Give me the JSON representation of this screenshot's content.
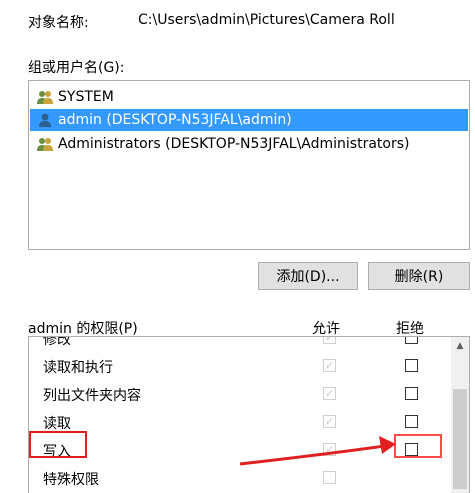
{
  "object": {
    "label": "对象名称:",
    "path": "C:\\Users\\admin\\Pictures\\Camera Roll"
  },
  "groups": {
    "label": "组或用户名(G):",
    "items": [
      {
        "label": "SYSTEM",
        "icon": "users-group-icon",
        "selected": false
      },
      {
        "label": "admin (DESKTOP-N53JFAL\\admin)",
        "icon": "user-icon",
        "selected": true
      },
      {
        "label": "Administrators (DESKTOP-N53JFAL\\Administrators)",
        "icon": "users-group-icon",
        "selected": false
      }
    ]
  },
  "buttons": {
    "add": "添加(D)...",
    "remove": "删除(R)"
  },
  "permissions": {
    "title": "admin 的权限(P)",
    "allow_header": "允许",
    "deny_header": "拒绝",
    "rows": [
      {
        "label": "修改",
        "allow": true,
        "deny": false
      },
      {
        "label": "读取和执行",
        "allow": true,
        "deny": false
      },
      {
        "label": "列出文件夹内容",
        "allow": true,
        "deny": false
      },
      {
        "label": "读取",
        "allow": true,
        "deny": false
      },
      {
        "label": "写入",
        "allow": true,
        "deny": false
      },
      {
        "label": "特殊权限",
        "allow": false,
        "deny": false
      }
    ]
  },
  "colors": {
    "selection": "#3399ff",
    "highlight": "#e02020"
  }
}
